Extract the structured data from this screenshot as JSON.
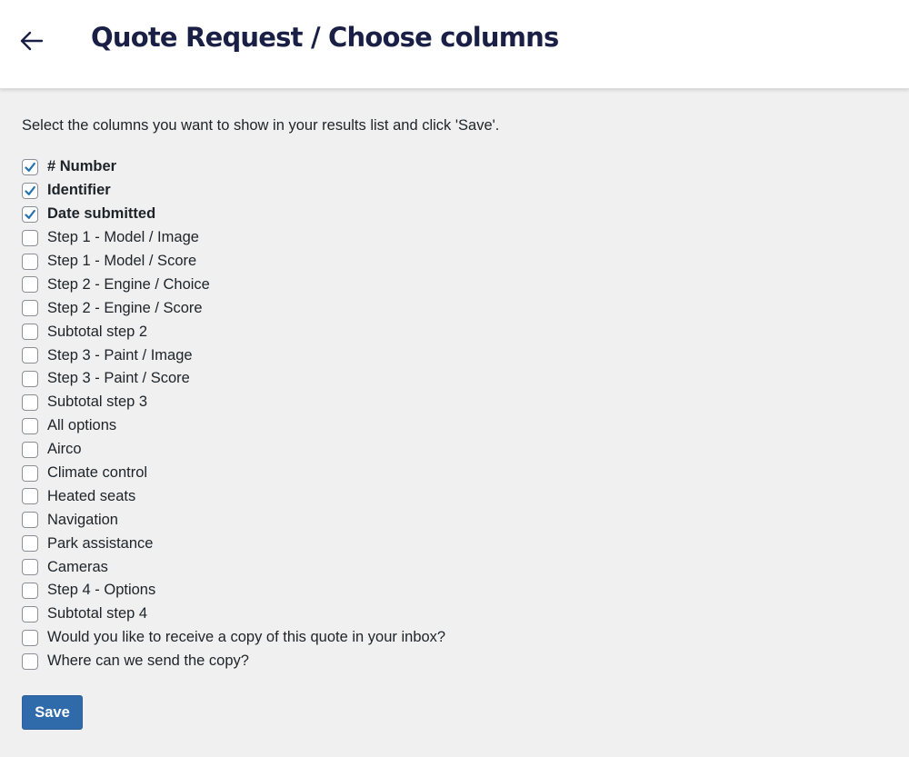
{
  "header": {
    "back_icon": "arrow-left-icon",
    "title": "Quote Request / Choose columns"
  },
  "intro": "Select the columns you want to show in your results list and click 'Save'.",
  "columns": [
    {
      "label": "# Number",
      "checked": true
    },
    {
      "label": "Identifier",
      "checked": true
    },
    {
      "label": "Date submitted",
      "checked": true
    },
    {
      "label": "Step 1 - Model / Image",
      "checked": false
    },
    {
      "label": "Step 1 - Model / Score",
      "checked": false
    },
    {
      "label": "Step 2 - Engine / Choice",
      "checked": false
    },
    {
      "label": "Step 2 - Engine / Score",
      "checked": false
    },
    {
      "label": "Subtotal step 2",
      "checked": false
    },
    {
      "label": "Step 3 - Paint / Image",
      "checked": false
    },
    {
      "label": "Step 3 - Paint / Score",
      "checked": false
    },
    {
      "label": "Subtotal step 3",
      "checked": false
    },
    {
      "label": "All options",
      "checked": false
    },
    {
      "label": "Airco",
      "checked": false
    },
    {
      "label": "Climate control",
      "checked": false
    },
    {
      "label": "Heated seats",
      "checked": false
    },
    {
      "label": "Navigation",
      "checked": false
    },
    {
      "label": "Park assistance",
      "checked": false
    },
    {
      "label": "Cameras",
      "checked": false
    },
    {
      "label": "Step 4 - Options",
      "checked": false
    },
    {
      "label": "Subtotal step 4",
      "checked": false
    },
    {
      "label": "Would you like to receive a copy of this quote in your inbox?",
      "checked": false
    },
    {
      "label": "Where can we send the copy?",
      "checked": false
    }
  ],
  "save_label": "Save",
  "colors": {
    "title": "#1a1f45",
    "button": "#2f6aab",
    "check": "#2271b1",
    "background": "#f0f0f1"
  }
}
